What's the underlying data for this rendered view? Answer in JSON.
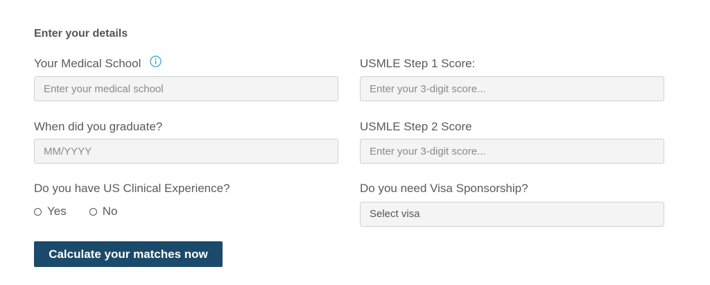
{
  "section_title": "Enter your details",
  "colors": {
    "accent": "#1b4a6b",
    "info_icon": "#2aa0c8",
    "field_bg": "#f4f4f4",
    "field_border": "#cfcfcf",
    "text": "#5a5a5a"
  },
  "medical_school": {
    "label": "Your Medical School",
    "info_icon": "info-circle-icon",
    "placeholder": "Enter your medical school"
  },
  "graduation": {
    "label": "When did you graduate?",
    "placeholder": "MM/YYYY"
  },
  "clinical_experience": {
    "label": "Do you have US Clinical Experience?",
    "options": [
      "Yes",
      "No"
    ]
  },
  "step1": {
    "label": "USMLE Step 1 Score:",
    "placeholder": "Enter your 3-digit score..."
  },
  "step2": {
    "label": "USMLE Step 2 Score",
    "placeholder": "Enter your 3-digit score..."
  },
  "visa": {
    "label": "Do you need Visa Sponsorship?",
    "selected": "Select visa"
  },
  "submit_label": "Calculate your matches now"
}
